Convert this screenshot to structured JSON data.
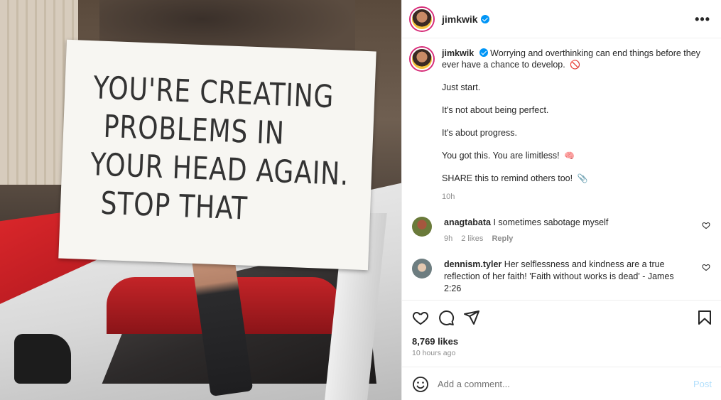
{
  "photo": {
    "sign_lines": [
      "YOU'RE CREATING",
      "PROBLEMS IN",
      "YOUR HEAD AGAIN.",
      "STOP THAT"
    ]
  },
  "header": {
    "username": "jimkwik",
    "more_icon": "more-horizontal-icon",
    "more_glyph": "•••"
  },
  "caption": {
    "username": "jimkwik",
    "lines": [
      "Worrying and overthinking can end things before they ever have a chance to develop.",
      "Just start.",
      "It's not about being perfect.",
      "It's about progress.",
      "You got this. You are limitless!",
      "SHARE this to remind others too!"
    ],
    "emojis": [
      "🚫",
      "🧠",
      "📎"
    ],
    "time": "10h"
  },
  "comments": [
    {
      "username": "anagtabata",
      "text": "I sometimes sabotage myself",
      "time": "9h",
      "likes": "2 likes",
      "reply": "Reply"
    },
    {
      "username": "dennism.tyler",
      "text": "Her selflessness and kindness are a true reflection of her faith! 'Faith without works is dead' - James 2:26"
    }
  ],
  "actions": {
    "likes": "8,769 likes",
    "ago": "10 hours ago"
  },
  "add_comment": {
    "placeholder": "Add a comment...",
    "post_label": "Post"
  },
  "colors": {
    "verified": "#0095f6",
    "post_disabled": "#b2dffc",
    "secondary_text": "#8e8e8e"
  }
}
